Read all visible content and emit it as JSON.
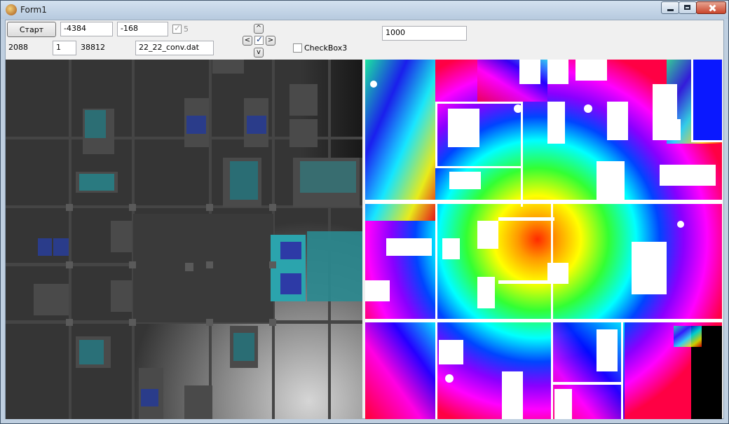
{
  "window": {
    "title": "Form1",
    "icon": "app-icon"
  },
  "controls": {
    "start_button": "Старт",
    "x_value": "-4384",
    "y_value": "-168",
    "check5_label": "5",
    "iterations_value": "1000",
    "count_label": "2088",
    "step_value": "1",
    "total_label": "38812",
    "file_value": "22_22_conv.dat",
    "checkbox3_label": "CheckBox3",
    "nav": {
      "up": "^",
      "left": "<",
      "right": ">",
      "down": "v"
    }
  },
  "colors": {
    "map_bg": "#333333",
    "cyan": "#2aa7b0",
    "blue": "#2233aa",
    "white": "#ffffff"
  }
}
